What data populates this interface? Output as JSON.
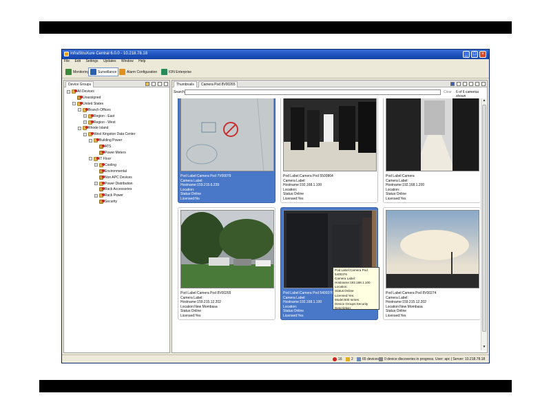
{
  "window": {
    "title": "InfraStruXure Central 6.0.0 - 10.218.78.18",
    "minimize_glyph": "_",
    "maximize_glyph": "□",
    "close_glyph": "×"
  },
  "menu": [
    "File",
    "Edit",
    "Settings",
    "Updates",
    "Window",
    "Help"
  ],
  "toolbar": {
    "buttons": [
      {
        "label": "Monitoring",
        "icon": "monitoring-icon"
      },
      {
        "label": "Surveillance",
        "icon": "camera-icon",
        "active": true
      },
      {
        "label": "Alarm Configuration",
        "icon": "alarm-icon"
      },
      {
        "label": "ION Enterprise",
        "icon": "ion-icon"
      }
    ]
  },
  "left_panel": {
    "tab_label": "Device Groups",
    "tree": [
      {
        "label": "All Devices",
        "level": 0,
        "expander": "−"
      },
      {
        "label": "Unassigned",
        "level": 1,
        "expander": ""
      },
      {
        "label": "United States",
        "level": 1,
        "expander": "−"
      },
      {
        "label": "Branch Offices",
        "level": 2,
        "expander": "−"
      },
      {
        "label": "Region - East",
        "level": 3,
        "expander": "+"
      },
      {
        "label": "Region - West",
        "level": 3,
        "expander": "+"
      },
      {
        "label": "Rhode Island",
        "level": 2,
        "expander": "−"
      },
      {
        "label": "West Kingston Data Center",
        "level": 3,
        "expander": "−"
      },
      {
        "label": "Building Power",
        "level": 4,
        "expander": "−"
      },
      {
        "label": "ATS",
        "level": 5,
        "expander": ""
      },
      {
        "label": "Power Meters",
        "level": 5,
        "expander": ""
      },
      {
        "label": "IT Floor",
        "level": 4,
        "expander": "−"
      },
      {
        "label": "Cooling",
        "level": 5,
        "expander": "+"
      },
      {
        "label": "Environmental",
        "level": 5,
        "expander": ""
      },
      {
        "label": "Non APC Devices",
        "level": 5,
        "expander": ""
      },
      {
        "label": "Power Distribution",
        "level": 5,
        "expander": "+"
      },
      {
        "label": "Rack Accessories",
        "level": 5,
        "expander": ""
      },
      {
        "label": "Rack Power",
        "level": 5,
        "expander": "+"
      },
      {
        "label": "Security",
        "level": 5,
        "expander": ""
      }
    ]
  },
  "right_panel": {
    "tabs": [
      "Thumbnails",
      "Camera Pod 8V00265"
    ],
    "search_label": "Search",
    "search_value": "",
    "clear_label": "Clear",
    "camera_count": "6 of 6 cameras shown",
    "scroll_up": "▲",
    "scroll_down": "▼"
  },
  "cameras": [
    {
      "lines": [
        "Pod Label:Camera Pod 7V00079",
        "Camera Label:",
        "Hostname:159.215.6.239",
        "Location:",
        "Status:Online",
        "Licensed:No"
      ],
      "selected": true,
      "scene": "whiteboard"
    },
    {
      "lines": [
        "Pod Label:Camera Pod 5500864",
        "Camera Label:",
        "Hostname:192.168.1.100",
        "Location:",
        "Status:Online",
        "Licensed:Yes"
      ],
      "selected": false,
      "scene": "datacenter"
    },
    {
      "lines": [
        "Pod Label:Camera",
        "Camera Label:",
        "Hostname:192.168.1.200",
        "Location:",
        "Status:Online",
        "Licensed:Yes"
      ],
      "selected": false,
      "scene": "datacenter2"
    },
    {
      "lines": [
        "Pod Label:Camera Pod 8V00265",
        "Camera Label:",
        "Hostname:159.215.12.202",
        "Location:New Mombasa",
        "Status:Online",
        "Licensed:Yes"
      ],
      "selected": false,
      "scene": "parking"
    },
    {
      "lines": [
        "Pod Label:Camera Pod 5400376",
        "Camera Label:",
        "Hostname:192.168.1.100",
        "Location:",
        "Status:Online",
        "Licensed:Yes"
      ],
      "selected": true,
      "scene": "rack"
    },
    {
      "lines": [
        "Pod Label:Camera Pod 8V00274",
        "Camera Label:",
        "Hostname:159.215.12.202",
        "Location:New Mombasa",
        "Status:Online",
        "Licensed:Yes"
      ],
      "selected": false,
      "scene": "sky"
    }
  ],
  "tooltip": {
    "lines": [
      "Pod Label:Camera Pod 5400376",
      "Camera Label:",
      "Hostname:192.168.1.100",
      "Location:",
      "Status:Online",
      "Licensed:Yes",
      "Model:500 series",
      "Device Groups:Security",
      "Description:"
    ]
  },
  "status_bar": {
    "alarm_count": "16",
    "warning_count": "2",
    "devices": "65 devices",
    "discoveries": "0 device discoveries in progress.",
    "user_server": "User: apc | Server: 10.218.78.18"
  }
}
